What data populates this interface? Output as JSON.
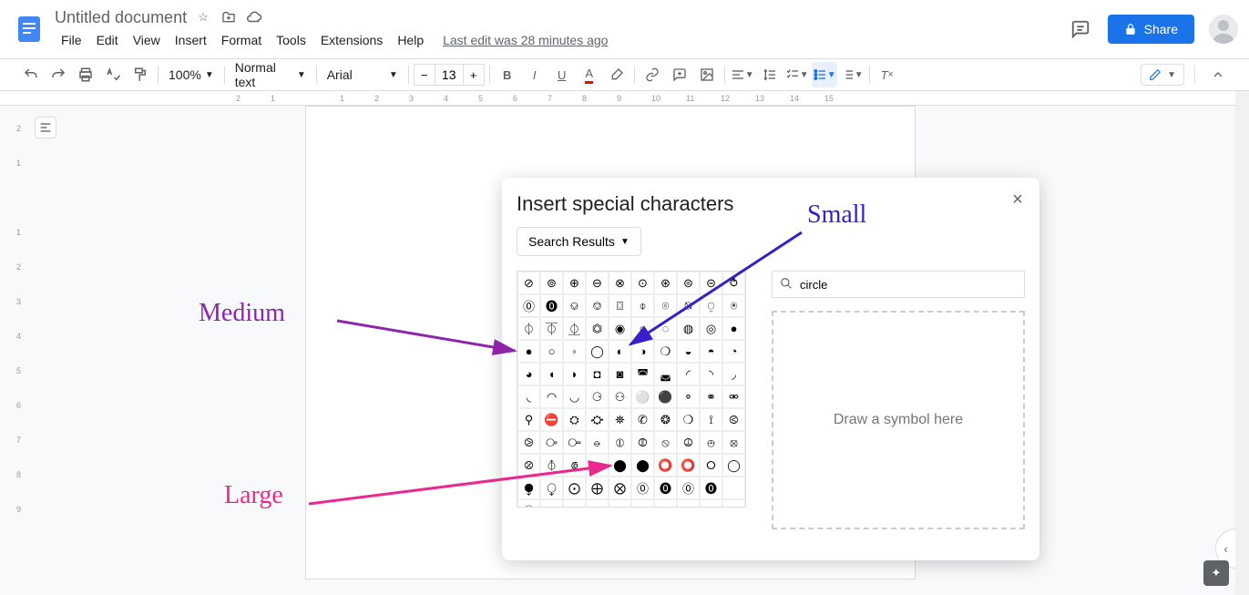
{
  "header": {
    "title": "Untitled document",
    "menus": [
      "File",
      "Edit",
      "View",
      "Insert",
      "Format",
      "Tools",
      "Extensions",
      "Help"
    ],
    "last_edit": "Last edit was 28 minutes ago",
    "share_label": "Share"
  },
  "toolbar": {
    "zoom": "100%",
    "style": "Normal text",
    "font": "Arial",
    "font_size": "13"
  },
  "dialog": {
    "title": "Insert special characters",
    "category_label": "Search Results",
    "search_value": "circle",
    "draw_placeholder": "Draw a symbol here",
    "chars": [
      "⊘",
      "⊚",
      "⊕",
      "⊖",
      "⊗",
      "⊙",
      "⊛",
      "⊜",
      "⊝",
      "⥀",
      "🄋",
      "🄌",
      "⎉",
      "⎊",
      "⌼",
      "⌽",
      "⌾",
      "⍉",
      "⍜",
      "⍟",
      "⏀",
      "⏁",
      "⏂",
      "⏣",
      "◉",
      "○",
      "◌",
      "◍",
      "◎",
      "●",
      "●",
      "○",
      "◦",
      "◯",
      "◐",
      "◑",
      "❍",
      "◒",
      "◓",
      "◔",
      "◕",
      "◖",
      "◗",
      "◘",
      "◙",
      "◚",
      "◛",
      "◜",
      "◝",
      "◞",
      "◟",
      "◠",
      "◡",
      "⚆",
      "⚇",
      "⚪",
      "⚫",
      "⚬",
      "⚭",
      "⚮",
      "⚲",
      "⛔",
      "⛭",
      "⛮",
      "⛯",
      "✆",
      "❂",
      "❍",
      "⟟",
      "⧀",
      "⧁",
      "⧂",
      "⧃",
      "⦵",
      "⦶",
      "⦷",
      "⦸",
      "⦹",
      "⦺",
      "⦻",
      "⦼",
      "⦽",
      "⟃",
      "⟄",
      "⬤",
      "⬤",
      "⭕",
      "⭕",
      "⭘",
      "◯",
      "⧭",
      "⧬",
      "⨀",
      "⨁",
      "⨂",
      "🄋",
      "🄌",
      "🄋",
      "🄌",
      "",
      "🄋",
      "",
      "",
      "",
      "",
      "",
      "",
      "",
      "",
      ""
    ]
  },
  "annotations": {
    "small": "Small",
    "medium": "Medium",
    "large": "Large"
  },
  "ruler_h": [
    "2",
    "1",
    "",
    "1",
    "2",
    "3",
    "4",
    "5",
    "6",
    "7",
    "8",
    "9",
    "10",
    "11",
    "12",
    "13",
    "14",
    "15"
  ],
  "ruler_v": [
    "2",
    "1",
    "",
    "1",
    "2",
    "3",
    "4",
    "5",
    "6",
    "7",
    "8",
    "9"
  ]
}
